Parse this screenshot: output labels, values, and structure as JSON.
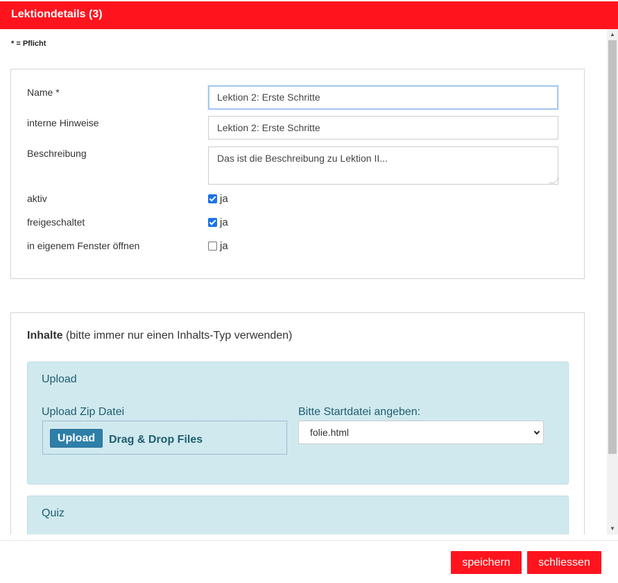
{
  "header": {
    "title": "Lektiondetails (3)"
  },
  "form": {
    "required_note": "* = Pflicht",
    "name": {
      "label": "Name *",
      "value": "Lektion 2: Erste Schritte"
    },
    "internal_notes": {
      "label": "interne Hinweise",
      "value": "Lektion 2: Erste Schritte"
    },
    "description": {
      "label": "Beschreibung",
      "value": "Das ist die Beschreibung zu Lektion II..."
    },
    "active": {
      "label": "aktiv",
      "checkbox_label": "ja",
      "checked": true
    },
    "unlocked": {
      "label": "freigeschaltet",
      "checkbox_label": "ja",
      "checked": true
    },
    "own_window": {
      "label": "in eigenem Fenster öffnen",
      "checkbox_label": "ja",
      "checked": false
    }
  },
  "contents": {
    "heading_bold": "Inhalte",
    "heading_rest": " (bitte immer nur einen Inhalts-Typ verwenden)",
    "upload": {
      "title": "Upload",
      "zip_label": "Upload Zip Datei",
      "upload_button": "Upload",
      "drag_drop": "Drag & Drop Files",
      "start_file_label": "Bitte Startdatei angeben:",
      "start_file_value": "folie.html"
    },
    "quiz": {
      "title": "Quiz"
    }
  },
  "footer": {
    "save": "speichern",
    "close": "schliessen"
  },
  "colors": {
    "brand_red": "#ff141e",
    "panel_teal": "#d0e9ef",
    "teal_text": "#1d5e6e"
  }
}
